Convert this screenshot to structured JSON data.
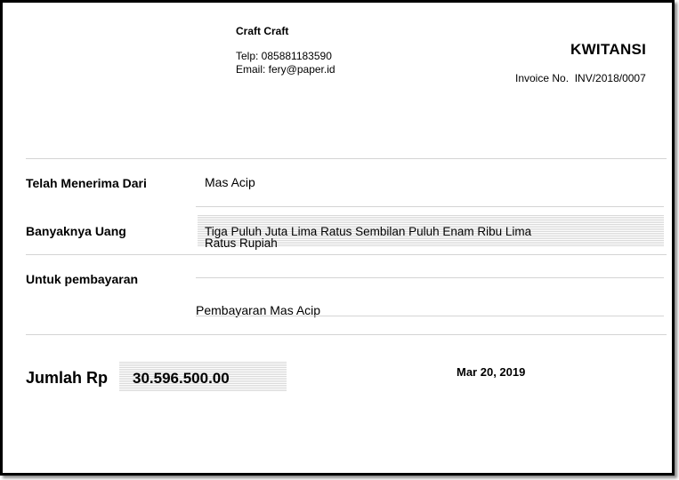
{
  "company": {
    "name": "Craft Craft",
    "phone": "Telp: 085881183590",
    "email": "Email: fery@paper.id"
  },
  "document": {
    "title": "KWITANSI",
    "invoice_label": "Invoice No.",
    "invoice_number": "INV/2018/0007"
  },
  "fields": {
    "received_from_label": "Telah Menerima Dari",
    "received_from_value": "Mas Acip",
    "amount_words_label": "Banyaknya Uang",
    "amount_words_line1": "Tiga Puluh Juta Lima Ratus Sembilan Puluh Enam Ribu Lima",
    "amount_words_line2": "Ratus Rupiah",
    "payment_for_label": "Untuk pembayaran",
    "payment_for_value": "Pembayaran Mas Acip"
  },
  "total": {
    "label": "Jumlah Rp",
    "value": "30.596.500.00"
  },
  "date": "Mar 20, 2019"
}
